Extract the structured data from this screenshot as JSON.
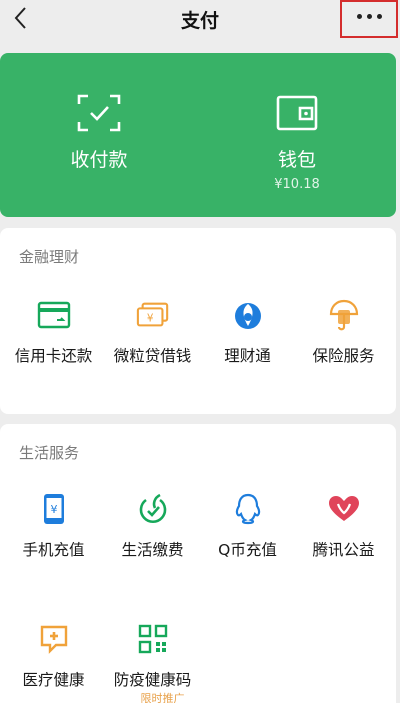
{
  "nav": {
    "title": "支付"
  },
  "top_card": {
    "collect_pay_label": "收付款",
    "wallet_label": "钱包",
    "wallet_balance": "¥10.18"
  },
  "finance": {
    "title": "金融理财",
    "items": [
      {
        "label": "信用卡还款",
        "icon": "credit-card-icon"
      },
      {
        "label": "微粒贷借钱",
        "icon": "loan-icon"
      },
      {
        "label": "理财通",
        "icon": "wealth-icon"
      },
      {
        "label": "保险服务",
        "icon": "insurance-icon"
      }
    ]
  },
  "life": {
    "title": "生活服务",
    "items": [
      {
        "label": "手机充值",
        "icon": "phone-topup-icon"
      },
      {
        "label": "生活缴费",
        "icon": "utility-bill-icon"
      },
      {
        "label": "Q币充值",
        "icon": "qcoin-icon"
      },
      {
        "label": "腾讯公益",
        "icon": "charity-icon"
      },
      {
        "label": "医疗健康",
        "icon": "medical-icon"
      },
      {
        "label": "防疫健康码",
        "icon": "qr-health-code-icon"
      }
    ],
    "ad_label": "限时推广"
  },
  "colors": {
    "green": "#38b267",
    "icon_green": "#16a85a",
    "icon_orange": "#f0a23a",
    "icon_blue": "#1e7ddc",
    "icon_red": "#e0445a",
    "highlight_red": "#d42d2d"
  }
}
